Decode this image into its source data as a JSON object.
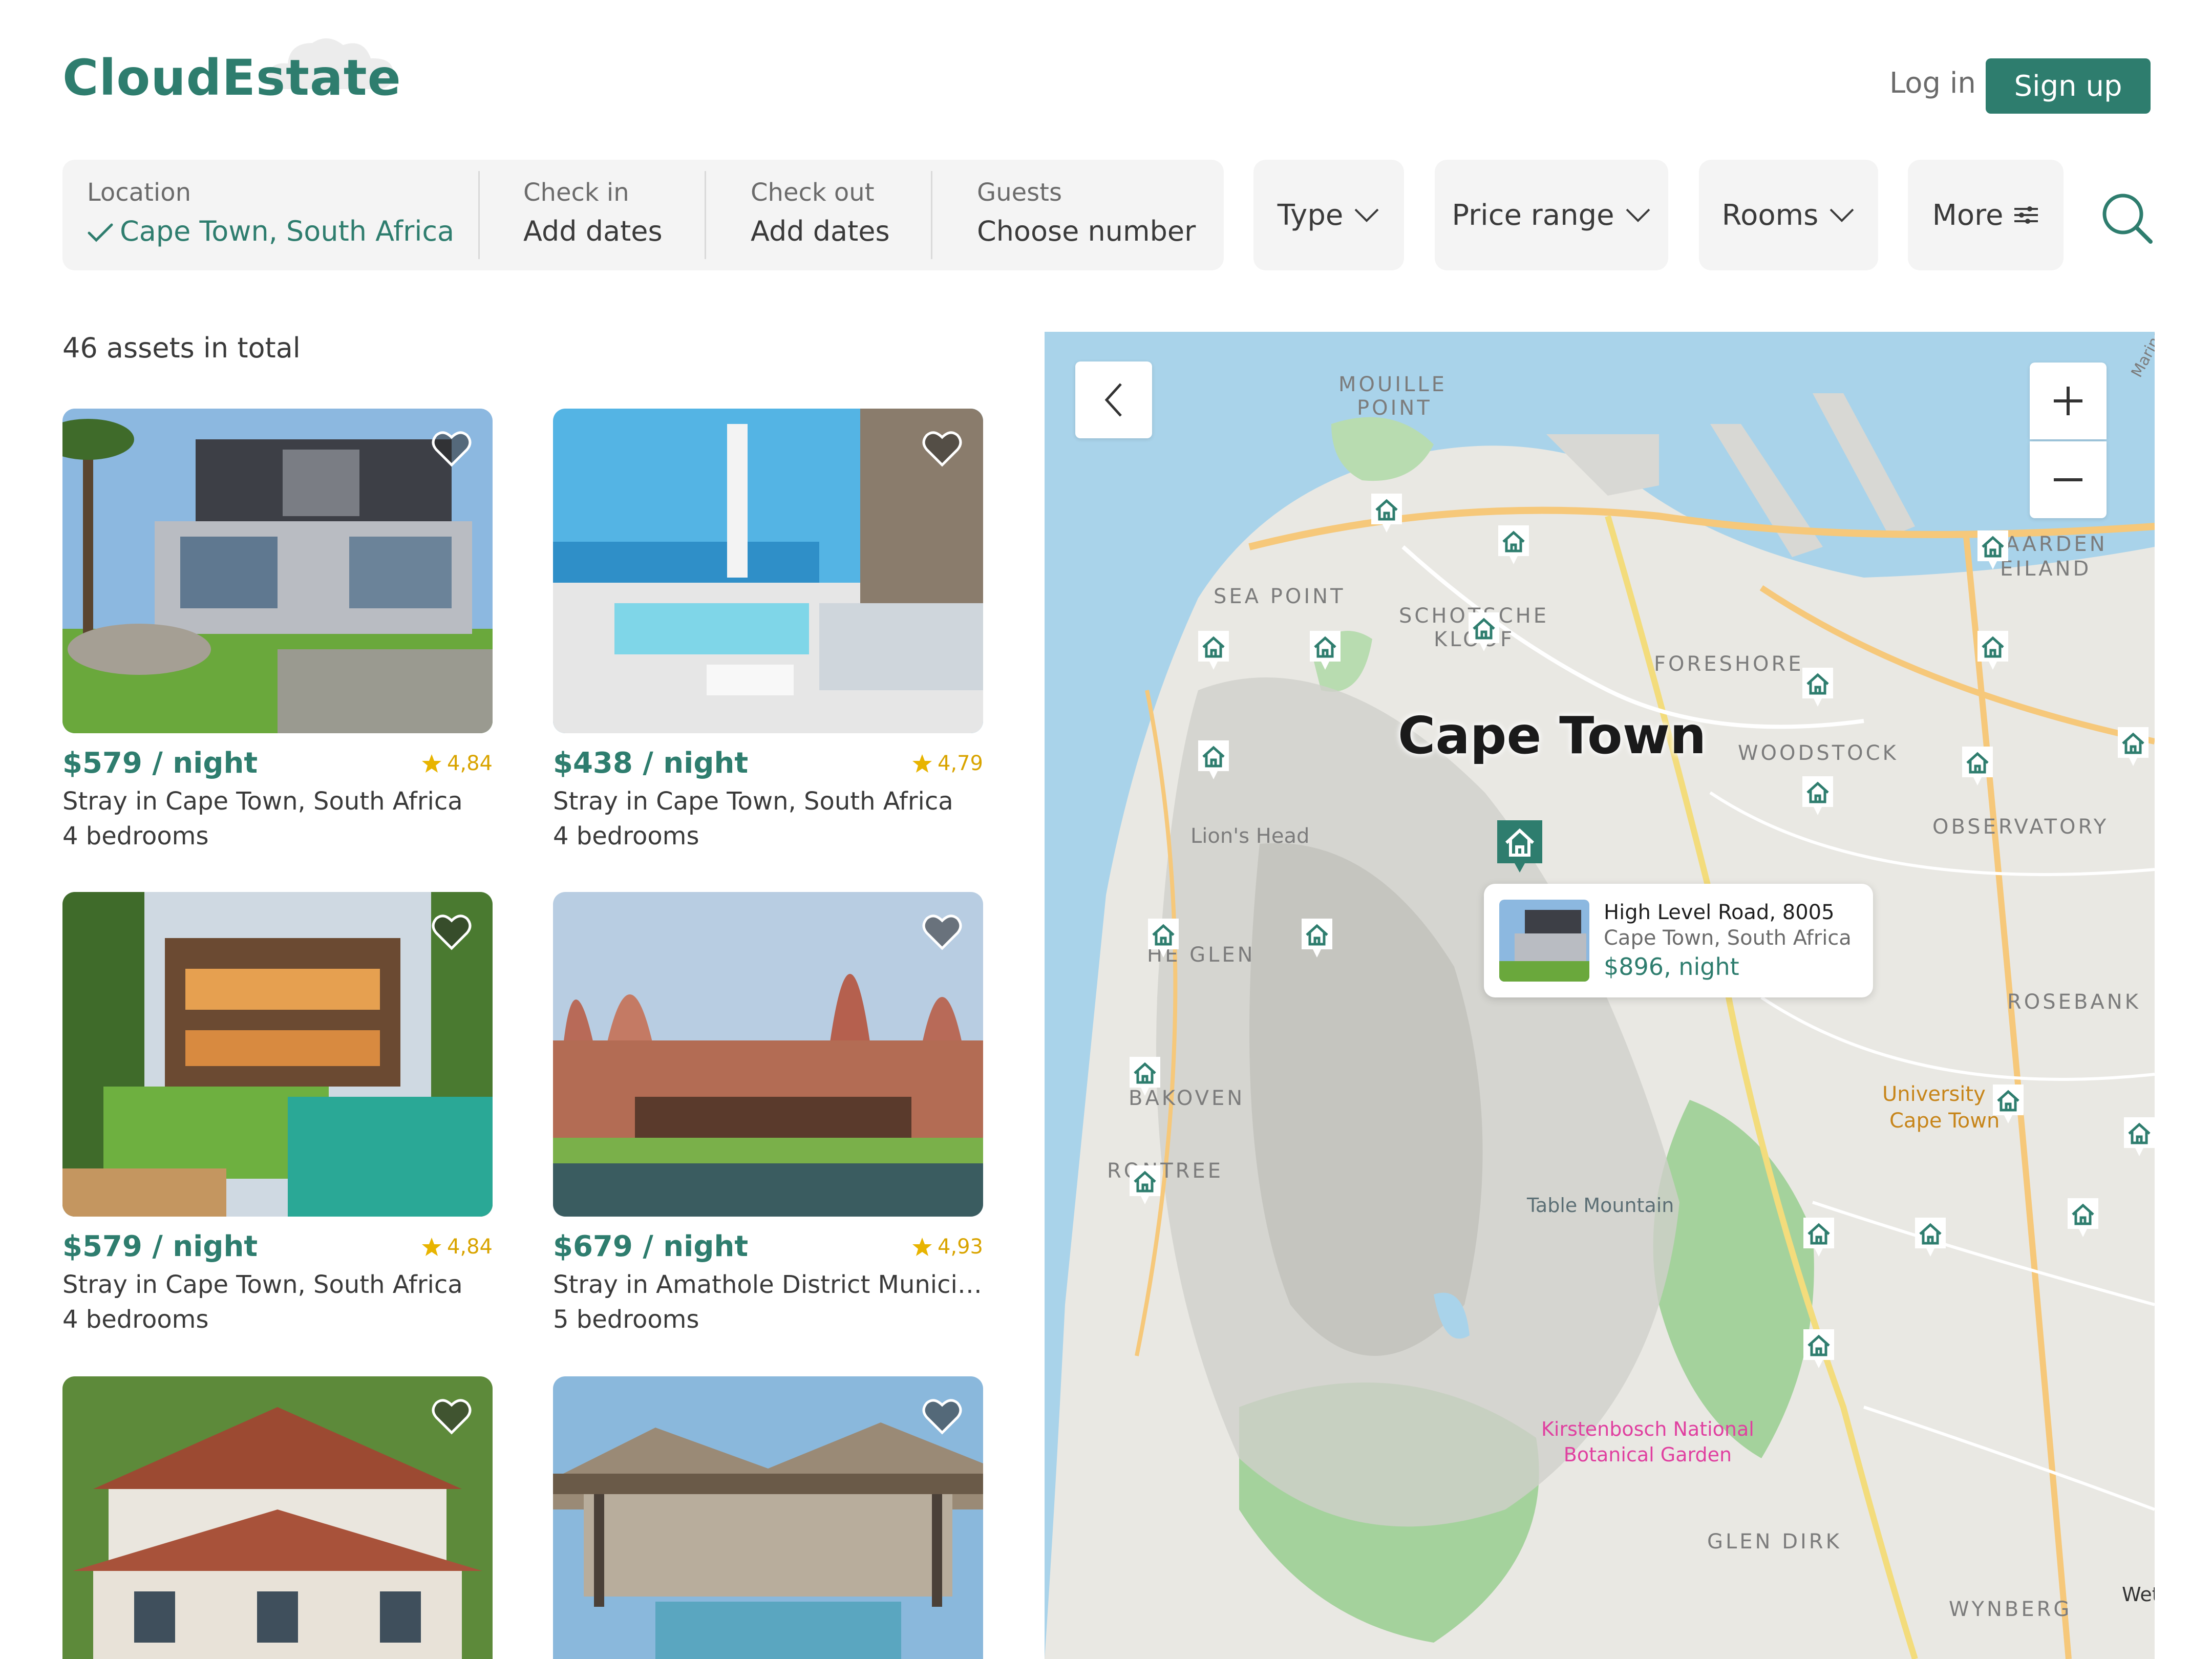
{
  "brand": {
    "name": "CloudEstate"
  },
  "header": {
    "login": "Log in",
    "signup": "Sign up"
  },
  "search": {
    "location": {
      "label": "Location",
      "value": "Cape Town, South Africa"
    },
    "checkin": {
      "label": "Check in",
      "value": "Add dates"
    },
    "checkout": {
      "label": "Check out",
      "value": "Add dates"
    },
    "guests": {
      "label": "Guests",
      "value": "Choose number"
    }
  },
  "filters": {
    "type": "Type",
    "price": "Price range",
    "rooms": "Rooms",
    "more": "More"
  },
  "results": {
    "total": "46 assets in total"
  },
  "listings": [
    {
      "price": "$579 / night",
      "rating": "4,84",
      "location": "Stray in Cape Town, South Africa",
      "bedrooms": "4 bedrooms"
    },
    {
      "price": "$438 / night",
      "rating": "4,79",
      "location": "Stray in Cape Town, South Africa",
      "bedrooms": "4 bedrooms"
    },
    {
      "price": "$579 / night",
      "rating": "4,84",
      "location": "Stray in Cape Town, South Africa",
      "bedrooms": "4 bedrooms"
    },
    {
      "price": "$679 / night",
      "rating": "4,93",
      "location": "Stray in Amathole District Municipal...",
      "bedrooms": "5 bedrooms"
    }
  ],
  "map": {
    "city": "Cape Town",
    "labels": {
      "mouille": "MOUILLE",
      "point": "POINT",
      "sea_point": "SEA POINT",
      "schotsche": "SCHOTSCHE",
      "kloof": "KLOOF",
      "foreshore": "FORESHORE",
      "woodstock": "WOODSTOCK",
      "observatory": "OBSERVATORY",
      "paarden": "AARDEN",
      "eiland": "EILAND",
      "lions_head": "Lion's Head",
      "glen": "HE GLEN",
      "bakoven": "BAKOVEN",
      "rontree": "RONTREE",
      "rosebank": "ROSEBANK",
      "university": "University",
      "cape_town_uni": "Cape Town",
      "table_mountain": "Table Mountain",
      "kirstenbosch1": "Kirstenbosch National",
      "kirstenbosch2": "Botanical Garden",
      "glen_dirk": "GLEN DIRK",
      "wynberg": "WYNBERG",
      "marine": "Marine",
      "wet": "Wet"
    },
    "popup": {
      "title": "High Level Road, 8005",
      "subtitle": "Cape Town, South Africa",
      "price": "$896, night"
    }
  }
}
